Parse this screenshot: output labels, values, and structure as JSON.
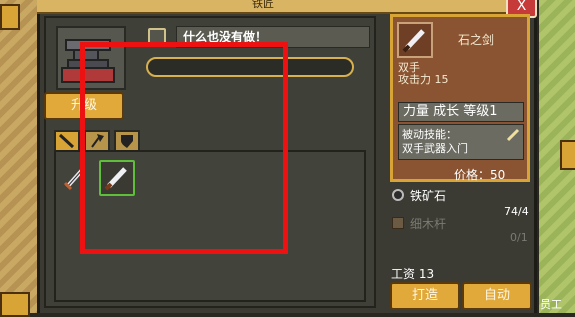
{
  "window": {
    "title": "铁匠",
    "close_label": "X"
  },
  "forge": {
    "item_name_field": "什么也没有做！",
    "upgrade_label": "升级",
    "tabs": [
      {
        "icon": "sword-icon",
        "active": true
      },
      {
        "icon": "axe-icon",
        "active": false
      },
      {
        "icon": "shield-icon",
        "active": false
      }
    ]
  },
  "item": {
    "name": "石之剑",
    "type": "双手",
    "attack_label": "攻击力 15",
    "stats": "力量 成长 等级1",
    "passive_label": "被动技能：",
    "passive_value": "双手武器入门",
    "price_label": "价格：50"
  },
  "materials": [
    {
      "name": "铁矿石",
      "count": "74/4",
      "enabled": true,
      "icon": "iron-ore-icon"
    },
    {
      "name": "细木杆",
      "count": "0/1",
      "enabled": false,
      "icon": "wood-stick-icon"
    }
  ],
  "wage_label": "工资 13",
  "buttons": {
    "forge": "打造",
    "auto": "自动"
  },
  "staff_label": "员工",
  "colors": {
    "accent": "#e1a939",
    "panel": "#8a5432",
    "selected": "#5fbf3a",
    "highlight": "#ee1111"
  }
}
